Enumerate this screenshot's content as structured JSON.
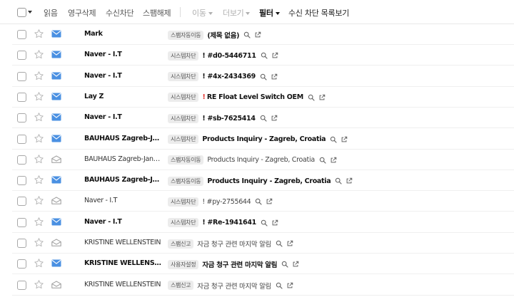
{
  "toolbar": {
    "read": "읽음",
    "permanent_delete": "영구삭제",
    "block_sender": "수신차단",
    "unspam": "스팸해제",
    "move": "이동",
    "more": "더보기",
    "filter": "필터",
    "block_list": "수신 차단 목록보기"
  },
  "colors": {
    "unread_envelope": "#4a90e2",
    "read_envelope": "#999999",
    "important": "#e53935",
    "tag_bg": "#ececec"
  },
  "mails": [
    {
      "sender": "Mark",
      "tag": "스팸자동이동",
      "important": false,
      "subject": "(제목 없음)",
      "unread": true
    },
    {
      "sender": "Naver - I.T",
      "tag": "시스템차단",
      "important": false,
      "subject": "! #d0-5446711",
      "unread": true
    },
    {
      "sender": "Naver - I.T",
      "tag": "시스템차단",
      "important": false,
      "subject": "! #4x-2434369",
      "unread": true
    },
    {
      "sender": "Lay Z",
      "tag": "시스템차단",
      "important": true,
      "important_mark": "!",
      "subject": "RE Float Level Switch OEM",
      "unread": true
    },
    {
      "sender": "Naver - I.T",
      "tag": "시스템차단",
      "important": false,
      "subject": "! #sb-7625414",
      "unread": true
    },
    {
      "sender": "BAUHAUS Zagreb-Jankomir",
      "tag": "시스템차단",
      "important": false,
      "subject": "Products Inquiry - Zagreb, Croatia",
      "unread": true
    },
    {
      "sender": "BAUHAUS Zagreb-Jankomir",
      "tag": "스팸자동이동",
      "important": false,
      "subject": "Products Inquiry - Zagreb, Croatia",
      "unread": false
    },
    {
      "sender": "BAUHAUS Zagreb-Jankomir",
      "tag": "스팸자동이동",
      "important": false,
      "subject": "Products Inquiry - Zagreb, Croatia",
      "unread": true
    },
    {
      "sender": "Naver - I.T",
      "tag": "시스템차단",
      "important": false,
      "subject": "! #py-2755644",
      "unread": false
    },
    {
      "sender": "Naver - I.T",
      "tag": "시스템차단",
      "important": false,
      "subject": "! #Re-1941641",
      "unread": true
    },
    {
      "sender": "KRISTINE WELLENSTEIN",
      "tag": "스팸신고",
      "important": false,
      "subject": "자금 청구 관련 마지막 알림",
      "unread": false
    },
    {
      "sender": "KRISTINE WELLENSTEIN",
      "tag": "사용자설정",
      "important": false,
      "subject": "자금 청구 관련 마지막 알림",
      "unread": true
    },
    {
      "sender": "KRISTINE WELLENSTEIN",
      "tag": "스팸신고",
      "important": false,
      "subject": "자금 청구 관련 마지막 알림",
      "unread": false
    }
  ]
}
